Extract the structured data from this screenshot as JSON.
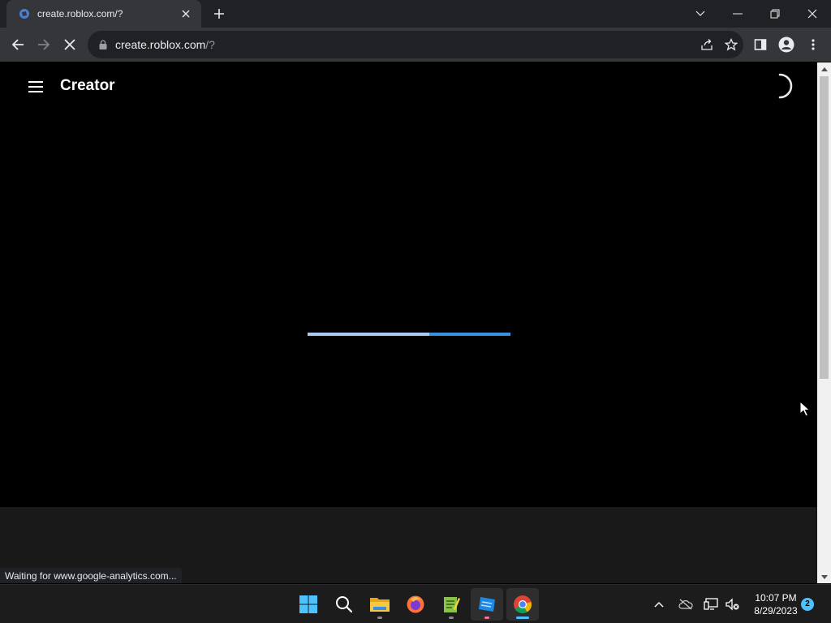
{
  "browser": {
    "tab": {
      "title": "create.roblox.com/?"
    },
    "address": {
      "host": "create.roblox.com",
      "path": "/?"
    }
  },
  "page": {
    "brand": "Creator",
    "loading_progress_percent": 60,
    "status_text": "Waiting for www.google-analytics.com..."
  },
  "taskbar": {
    "apps": [
      "start-icon",
      "search-icon",
      "file-explorer-icon",
      "firefox-icon",
      "notepad-icon",
      "roblox-studio-icon",
      "chrome-icon"
    ],
    "clock": {
      "time": "10:07 PM",
      "date": "8/29/2023"
    },
    "notification_count": "2"
  },
  "colors": {
    "chrome_dark": "#202124",
    "chrome_toolbar": "#35363a",
    "progress_light": "#a8cdf2",
    "progress_dark": "#3b8fe0",
    "accent": "#4cc2ff"
  }
}
